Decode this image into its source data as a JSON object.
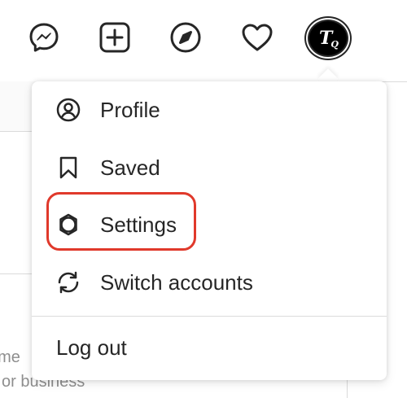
{
  "nav": {
    "icons": [
      "messenger-icon",
      "new-post-icon",
      "explore-compass-icon",
      "activity-heart-icon"
    ],
    "avatar_initials": "T",
    "avatar_sub": "Q"
  },
  "background": {
    "text_line1": "ame",
    "text_line2": "or business"
  },
  "menu": {
    "items": [
      {
        "label": "Profile",
        "icon": "profile-icon"
      },
      {
        "label": "Saved",
        "icon": "bookmark-icon"
      },
      {
        "label": "Settings",
        "icon": "settings-gear-icon"
      },
      {
        "label": "Switch accounts",
        "icon": "switch-accounts-icon"
      }
    ],
    "logout_label": "Log out",
    "highlight_color": "#e0392b"
  }
}
